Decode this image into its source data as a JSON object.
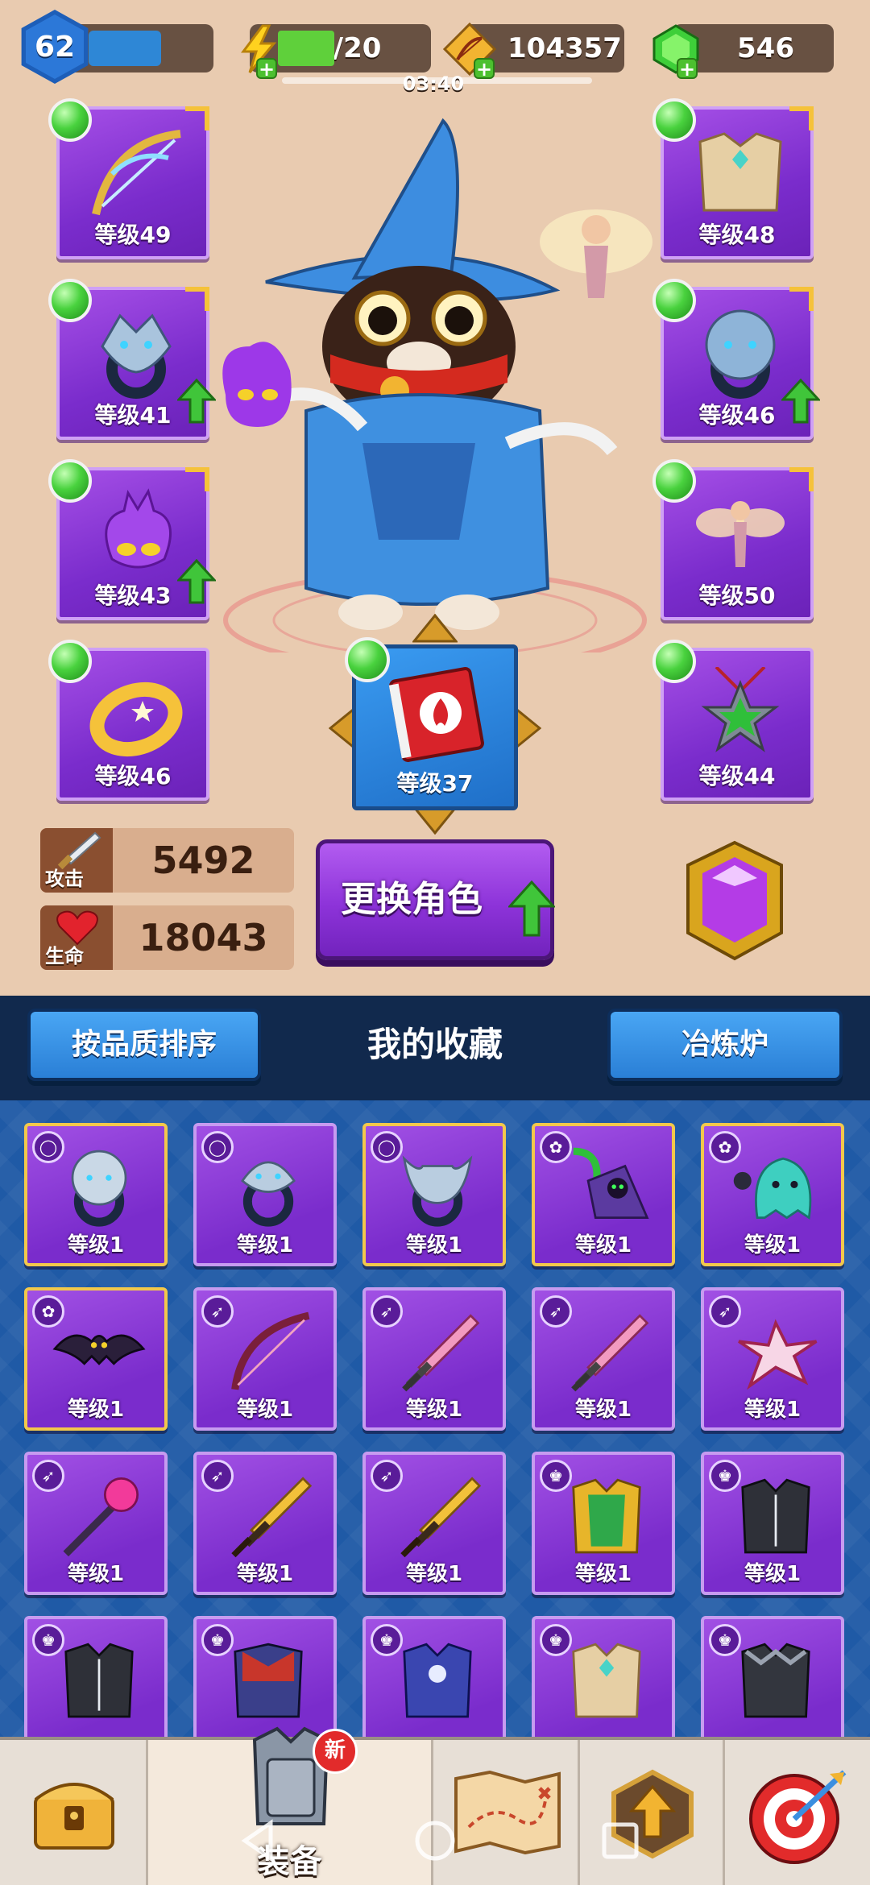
{
  "hud": {
    "player_level": "62",
    "energy": "8/20",
    "energy_fill": 0.4,
    "energy_timer": "03:40",
    "tickets": "104357",
    "gems": "546",
    "icons": [
      "energy-bolt-icon",
      "bow-ticket-icon",
      "emerald-gem-icon",
      "plus-icon"
    ]
  },
  "equipment": {
    "left": [
      {
        "name": "bow",
        "label": "等级49"
      },
      {
        "name": "wolf-ring",
        "label": "等级41",
        "upgrade": true
      },
      {
        "name": "purple-spirit",
        "label": "等级43",
        "upgrade": true
      },
      {
        "name": "gold-bracelet",
        "label": "等级46"
      }
    ],
    "right": [
      {
        "name": "armor",
        "label": "等级48"
      },
      {
        "name": "lion-ring",
        "label": "等级46",
        "upgrade": true
      },
      {
        "name": "fairy",
        "label": "等级50"
      },
      {
        "name": "star-amulet",
        "label": "等级44"
      }
    ],
    "book": {
      "label": "等级37"
    }
  },
  "stats": {
    "attack_label": "攻击",
    "attack_value": "5492",
    "hp_label": "生命",
    "hp_value": "18043"
  },
  "change_hero_label": "更换角色",
  "collection": {
    "sort_button": "按品质排序",
    "title": "我的收藏",
    "smelter_button": "冶炼炉",
    "items": [
      {
        "type": "ring",
        "art": "bear-ring",
        "label": "等级1",
        "rare": true
      },
      {
        "type": "ring",
        "art": "serpent-ring",
        "label": "等级1",
        "rare": false
      },
      {
        "type": "ring",
        "art": "bull-ring",
        "label": "等级1",
        "rare": true
      },
      {
        "type": "pet",
        "art": "scythe-ghost",
        "label": "等级1",
        "rare": true
      },
      {
        "type": "pet",
        "art": "teal-ghost",
        "label": "等级1",
        "rare": true
      },
      {
        "type": "pet",
        "art": "bat",
        "label": "等级1",
        "rare": true
      },
      {
        "type": "weapon",
        "art": "dark-bow",
        "label": "等级1",
        "rare": false
      },
      {
        "type": "weapon",
        "art": "pink-sword",
        "label": "等级1",
        "rare": false
      },
      {
        "type": "weapon",
        "art": "pink-sword",
        "label": "等级1",
        "rare": false
      },
      {
        "type": "weapon",
        "art": "shuriken",
        "label": "等级1",
        "rare": false
      },
      {
        "type": "weapon",
        "art": "staff",
        "label": "等级1",
        "rare": false
      },
      {
        "type": "weapon",
        "art": "gold-sword",
        "label": "等级1",
        "rare": false
      },
      {
        "type": "weapon",
        "art": "gold-sword",
        "label": "等级1",
        "rare": false
      },
      {
        "type": "armor",
        "art": "gold-armor",
        "label": "等级1",
        "rare": false
      },
      {
        "type": "armor",
        "art": "dark-vest",
        "label": "等级1",
        "rare": false
      },
      {
        "type": "armor",
        "art": "dark-vest",
        "label": "",
        "rare": false
      },
      {
        "type": "armor",
        "art": "red-cloak",
        "label": "",
        "rare": false
      },
      {
        "type": "armor",
        "art": "blue-robe",
        "label": "",
        "rare": false
      },
      {
        "type": "armor",
        "art": "light-armor",
        "label": "",
        "rare": false
      },
      {
        "type": "armor",
        "art": "black-armor",
        "label": "",
        "rare": false
      }
    ]
  },
  "nav": {
    "tabs": [
      {
        "name": "chest",
        "label": ""
      },
      {
        "name": "equipment",
        "label": "装备",
        "badge": "新"
      },
      {
        "name": "map",
        "label": ""
      },
      {
        "name": "upgrade",
        "label": ""
      },
      {
        "name": "target",
        "label": ""
      }
    ]
  },
  "colors": {
    "bg_top": "#e9cbb0",
    "panel_blue": "#1f5aa6",
    "slot_purple": "#8a3ad6",
    "accent_green": "#49d23e",
    "gold": "#f5c23a"
  }
}
